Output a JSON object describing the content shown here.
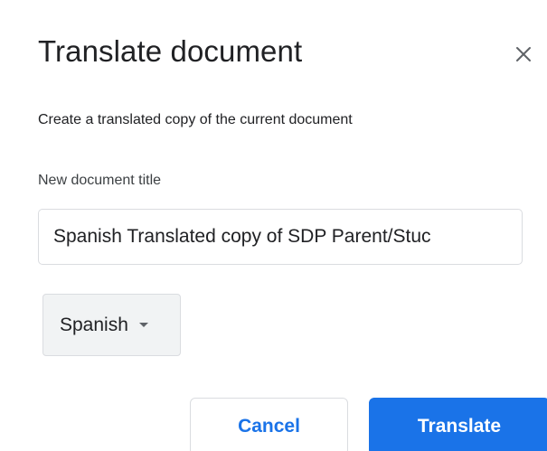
{
  "dialog": {
    "title": "Translate document",
    "close_icon": "close-icon",
    "subtitle": "Create a translated copy of the current document",
    "field_label": "New document title",
    "title_input_value": "Spanish Translated copy of SDP Parent/Stuc",
    "language": {
      "selected": "Spanish"
    },
    "buttons": {
      "cancel_label": "Cancel",
      "translate_label": "Translate"
    }
  },
  "colors": {
    "accent": "#1a73e8",
    "text": "#202124",
    "border": "#dadce0",
    "select_bg": "#f1f3f4"
  }
}
